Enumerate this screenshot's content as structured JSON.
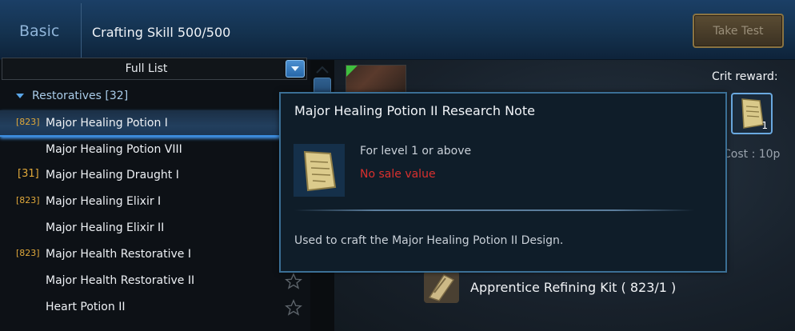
{
  "header": {
    "tab_label": "Basic",
    "skill_text": "Crafting Skill 500/500",
    "take_test_label": "Take Test"
  },
  "list": {
    "filter_value": "Full List",
    "category_label": "Restoratives [32]",
    "items": [
      {
        "badge": "[823]",
        "label": "Major Healing Potion I"
      },
      {
        "badge": "",
        "label": "Major Healing Potion VIII"
      },
      {
        "badge": "[31]",
        "label": "Major Healing Draught I"
      },
      {
        "badge": "[823]",
        "label": "Major Healing Elixir I"
      },
      {
        "badge": "",
        "label": "Major Healing Elixir II"
      },
      {
        "badge": "[823]",
        "label": "Major Health Restorative I"
      },
      {
        "badge": "",
        "label": "Major Health Restorative II"
      },
      {
        "badge": "",
        "label": "Heart Potion II"
      }
    ]
  },
  "detail": {
    "crit_reward_label": "Crit reward:",
    "crit_reward_count": "1",
    "cost_text": "Cost : 10p",
    "material_label": "Apprentice Refining Kit ( 823/1 )"
  },
  "tooltip": {
    "title": "Major Healing Potion II Research Note",
    "level_text": "For level 1 or above",
    "sale_text": "No sale value",
    "description": "Used to craft the Major Healing Potion II Design."
  },
  "icons": {
    "research_note": "scroll-icon",
    "star": "star-icon",
    "kit": "refining-kit-icon"
  },
  "colors": {
    "accent": "#4aa2ff",
    "badge": "#e0a83a",
    "warning": "#d9302e"
  }
}
